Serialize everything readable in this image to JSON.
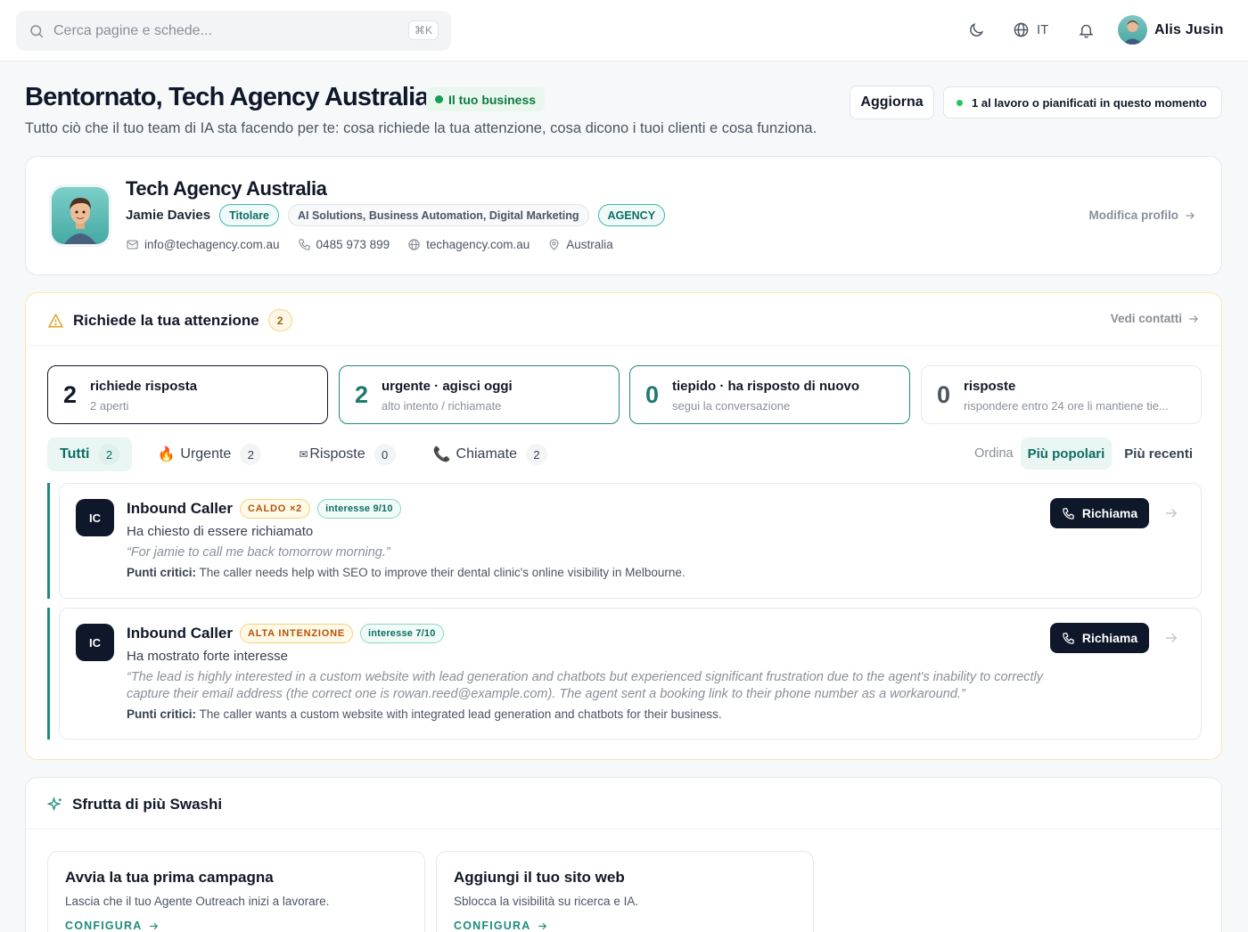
{
  "topbar": {
    "search_placeholder": "Cerca pagine e schede...",
    "search_shortcut": "⌘K",
    "language": "IT",
    "user_name": "Alis Jusin"
  },
  "header": {
    "title": "Bentornato, Tech Agency Australia",
    "business_badge": "Il tuo business",
    "subtitle": "Tutto ciò che il tuo team di IA sta facendo per te: cosa richiede la tua attenzione, cosa dicono i tuoi clienti e cosa funziona.",
    "update_button": "Aggiorna",
    "status_text": "1 al lavoro o pianificati in questo momento"
  },
  "profile": {
    "company": "Tech Agency Australia",
    "owner_name": "Jamie Davies",
    "owner_role": "Titolare",
    "services": "AI Solutions, Business Automation, Digital Marketing",
    "type_badge": "AGENCY",
    "email": "info@techagency.com.au",
    "phone": "0485 973 899",
    "website": "techagency.com.au",
    "location": "Australia",
    "edit_link": "Modifica profilo"
  },
  "attention": {
    "title": "Richiede la tua attenzione",
    "count": "2",
    "see_contacts": "Vedi contatti",
    "stats": [
      {
        "value": "2",
        "label": "richiede risposta",
        "sub": "2 aperti"
      },
      {
        "value": "2",
        "label": "urgente · agisci oggi",
        "sub": "alto intento / richiamate"
      },
      {
        "value": "0",
        "label": "tiepido · ha risposto di nuovo",
        "sub": "segui la conversazione"
      },
      {
        "value": "0",
        "label": "risposte",
        "sub": "rispondere entro 24 ore li mantiene tie..."
      }
    ],
    "filters": [
      {
        "label": "Tutti",
        "count": "2",
        "icon": ""
      },
      {
        "label": "Urgente",
        "count": "2",
        "icon": "🔥"
      },
      {
        "label": "Risposte",
        "count": "0",
        "icon": "✉"
      },
      {
        "label": "Chiamate",
        "count": "2",
        "icon": "📞"
      }
    ],
    "sort_label": "Ordina",
    "sort_options": [
      "Più popolari",
      "Più recenti"
    ],
    "leads": [
      {
        "initials": "IC",
        "name": "Inbound Caller",
        "tag": "CALDO ×2",
        "interest": "interesse 9/10",
        "description": "Ha chiesto di essere richiamato",
        "quote": "“For jamie to call me back tomorrow morning.”",
        "points_label": "Punti critici:",
        "points": "The caller needs help with SEO to improve their dental clinic's online visibility in Melbourne.",
        "call_button": "Richiama"
      },
      {
        "initials": "IC",
        "name": "Inbound Caller",
        "tag": "ALTA INTENZIONE",
        "interest": "interesse 7/10",
        "description": "Ha mostrato forte interesse",
        "quote": "“The lead is highly interested in a custom website with lead generation and chatbots but experienced significant frustration due to the agent's inability to correctly capture their email address (the correct one is rowan.reed@example.com). The agent sent a booking link to their phone number as a workaround.”",
        "points_label": "Punti critici:",
        "points": "The caller wants a custom website with integrated lead generation and chatbots for their business.",
        "call_button": "Richiama"
      }
    ]
  },
  "exploit": {
    "title": "Sfrutta di più Swashi",
    "tiles": [
      {
        "title": "Avvia la tua prima campagna",
        "description": "Lascia che il tuo Agente Outreach inizi a lavorare.",
        "cta": "CONFIGURA"
      },
      {
        "title": "Aggiungi il tuo sito web",
        "description": "Sblocca la visibilità su ricerca e IA.",
        "cta": "CONFIGURA"
      }
    ]
  },
  "colors": {
    "accent_teal": "#1f8a7e",
    "dark": "#0f172a",
    "warning_border": "#fbe6b3",
    "success": "#13a055"
  },
  "icons": [
    "search-icon",
    "moon-icon",
    "globe-icon",
    "bell-icon",
    "mail-icon",
    "phone-icon",
    "globe-icon",
    "map-pin-icon",
    "arrow-right-icon",
    "warning-icon",
    "fire-icon",
    "envelope-icon",
    "phone-icon",
    "sparkles-icon"
  ]
}
